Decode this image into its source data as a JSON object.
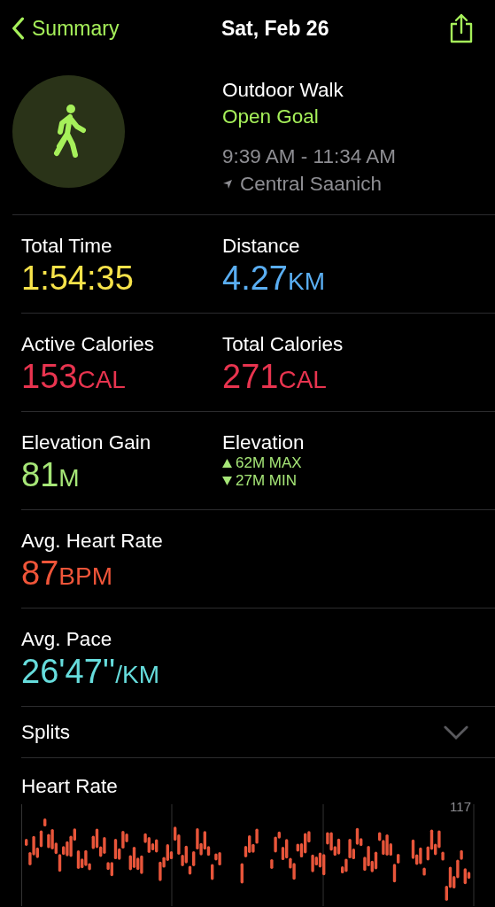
{
  "nav": {
    "back_label": "Summary",
    "title": "Sat, Feb 26"
  },
  "workout": {
    "name": "Outdoor Walk",
    "goal": "Open Goal",
    "time_range": "9:39 AM - 11:34 AM",
    "location": "Central Saanich"
  },
  "metric_rows": [
    {
      "kind": "pair",
      "cells": [
        {
          "label": "Total Time",
          "value": "1:54:35",
          "color": "#f7e34a"
        },
        {
          "label": "Distance",
          "value": "4.27",
          "unit": "KM",
          "color": "#5aaef2"
        }
      ]
    },
    {
      "kind": "pair",
      "cells": [
        {
          "label": "Active Calories",
          "value": "153",
          "unit": "CAL",
          "color": "#e8344f"
        },
        {
          "label": "Total Calories",
          "value": "271",
          "unit": "CAL",
          "color": "#e8344f"
        }
      ]
    },
    {
      "kind": "elevation",
      "cells": [
        {
          "label": "Elevation Gain",
          "value": "81",
          "unit": "M",
          "color": "#a6e677"
        },
        {
          "label": "Elevation",
          "max": "62M MAX",
          "min": "27M MIN",
          "color": "#a6e677"
        }
      ]
    },
    {
      "kind": "single",
      "cells": [
        {
          "label": "Avg. Heart Rate",
          "value": "87",
          "unit": "BPM",
          "color": "#f05539"
        }
      ]
    },
    {
      "kind": "single",
      "cells": [
        {
          "label": "Avg. Pace",
          "value": "26'47''",
          "unit": "/KM",
          "color": "#66dcdc"
        }
      ]
    }
  ],
  "splits": {
    "label": "Splits",
    "expanded": false
  },
  "heart_rate": {
    "title": "Heart Rate",
    "top_label": "117"
  }
}
